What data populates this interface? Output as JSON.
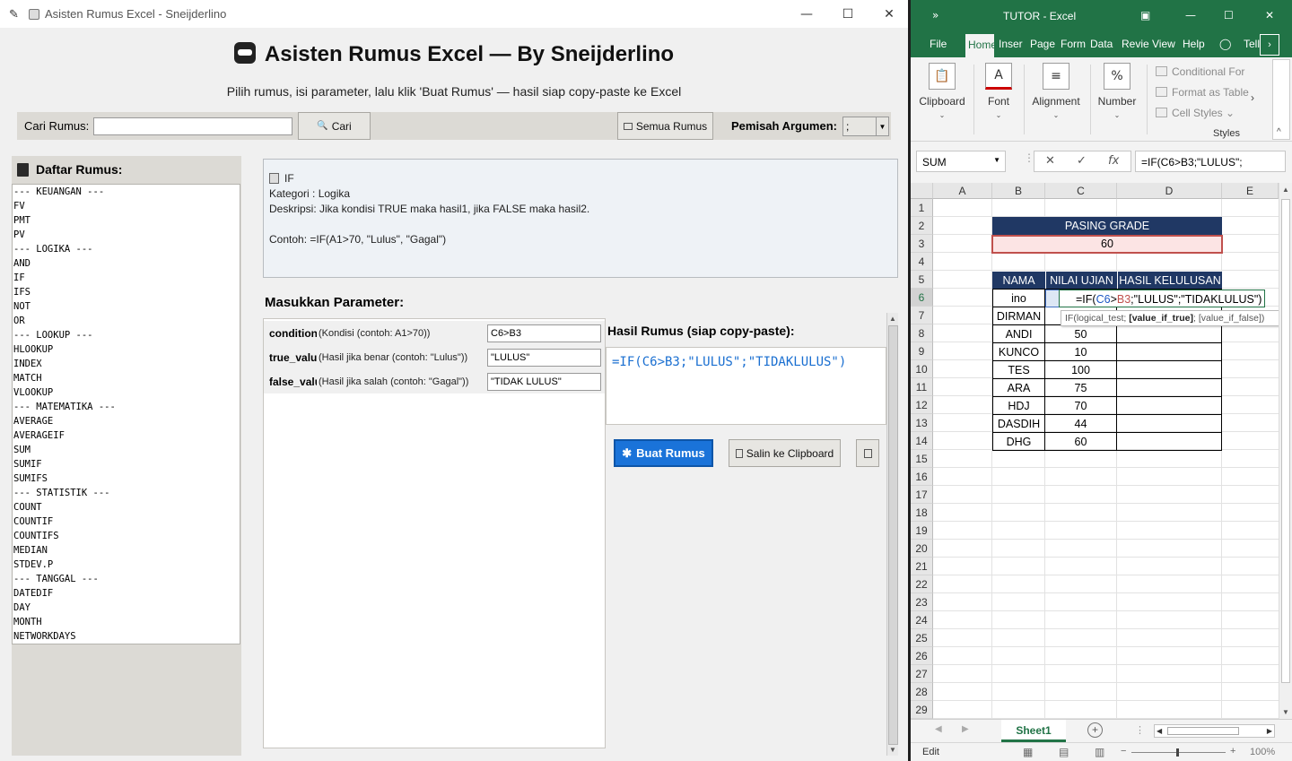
{
  "tk_window": {
    "title": "Asisten Rumus Excel - Sneijderlino",
    "app_title": "Asisten Rumus Excel — By Sneijderlino",
    "subtitle": "Pilih rumus, isi parameter, lalu klik 'Buat Rumus' — hasil siap copy-paste ke Excel",
    "search": {
      "label": "Cari Rumus:",
      "value": "",
      "search_button": "Cari",
      "all_button": "Semua Rumus",
      "separator_label": "Pemisah Argumen:",
      "separator_value": ";"
    },
    "list": {
      "header": "Daftar Rumus:",
      "items": [
        "--- KEUANGAN ---",
        "FV",
        "PMT",
        "PV",
        "--- LOGIKA ---",
        "AND",
        "IF",
        "IFS",
        "NOT",
        "OR",
        "--- LOOKUP ---",
        "HLOOKUP",
        "INDEX",
        "MATCH",
        "VLOOKUP",
        "--- MATEMATIKA ---",
        "AVERAGE",
        "AVERAGEIF",
        "SUM",
        "SUMIF",
        "SUMIFS",
        "--- STATISTIK ---",
        "COUNT",
        "COUNTIF",
        "COUNTIFS",
        "MEDIAN",
        "STDEV.P",
        "--- TANGGAL ---",
        "DATEDIF",
        "DAY",
        "MONTH",
        "NETWORKDAYS"
      ]
    },
    "detail": {
      "name": "IF",
      "category": "Kategori : Logika",
      "description": "Deskripsi: Jika kondisi TRUE maka hasil1, jika FALSE maka hasil2.",
      "example": "Contoh: =IF(A1>70, \"Lulus\", \"Gagal\")"
    },
    "params": {
      "title": "Masukkan Parameter:",
      "rows": [
        {
          "name": "condition",
          "desc": "(Kondisi (contoh: A1>70))",
          "value": "C6>B3"
        },
        {
          "name": "true_value",
          "desc": "(Hasil jika benar (contoh: \"Lulus\"))",
          "value": "\"LULUS\""
        },
        {
          "name": "false_value",
          "desc": "(Hasil jika salah (contoh: \"Gagal\"))",
          "value": "\"TIDAK LULUS\""
        }
      ]
    },
    "result": {
      "title": "Hasil Rumus (siap copy-paste):",
      "formula": "=IF(C6>B3;\"LULUS\";\"TIDAKLULUS\")",
      "build_button": "Buat Rumus",
      "copy_button": "Salin ke Clipboard"
    }
  },
  "excel": {
    "title": "TUTOR  -  Excel",
    "tabs": [
      "File",
      "Home",
      "Inser",
      "Page",
      "Form",
      "Data",
      "Revie",
      "View",
      "Help",
      "Tell"
    ],
    "ribbon": {
      "groups": [
        "Clipboard",
        "Font",
        "Alignment",
        "Number"
      ],
      "styles": [
        "Conditional For",
        "Format as Table",
        "Cell Styles"
      ],
      "styles_label": "Styles"
    },
    "name_box": "SUM",
    "formula_bar": "=IF(C6>B3;\"LULUS\";",
    "columns": [
      "A",
      "B",
      "C",
      "D",
      "E"
    ],
    "rows": [
      "1",
      "2",
      "3",
      "4",
      "5",
      "6",
      "7",
      "8",
      "9",
      "10",
      "11",
      "12",
      "13",
      "14",
      "15",
      "16",
      "17",
      "18",
      "19",
      "20",
      "21",
      "22",
      "23",
      "24",
      "25",
      "26",
      "27",
      "28",
      "29"
    ],
    "passing_grade_label": "PASING GRADE",
    "passing_grade_value": "60",
    "table_headers": [
      "NAMA",
      "NILAI UJIAN",
      "HASIL KELULUSAN"
    ],
    "table_rows": [
      {
        "name": "ino",
        "score": ""
      },
      {
        "name": "DIRMAN",
        "score": ""
      },
      {
        "name": "ANDI",
        "score": "50"
      },
      {
        "name": "KUNCO",
        "score": "10"
      },
      {
        "name": "TES",
        "score": "100"
      },
      {
        "name": "ARA",
        "score": "75"
      },
      {
        "name": "HDJ",
        "score": "70"
      },
      {
        "name": "DASDIH",
        "score": "44"
      },
      {
        "name": "DHG",
        "score": "60"
      }
    ],
    "editing_formula": {
      "prefix": "=IF(",
      "ref1": "C6",
      "op": ">",
      "ref2": "B3",
      "suffix": ";\"LULUS\";\"TIDAKLULUS\")"
    },
    "tooltip": {
      "prefix": "IF(logical_test; ",
      "bold": "[value_if_true]",
      "suffix": "; [value_if_false])"
    },
    "sheet_tab": "Sheet1",
    "status": {
      "mode": "Edit",
      "zoom": "100%"
    },
    "colors": {
      "accent": "#217346",
      "header_fill": "#203864",
      "pink_fill": "#fce4e4"
    }
  }
}
